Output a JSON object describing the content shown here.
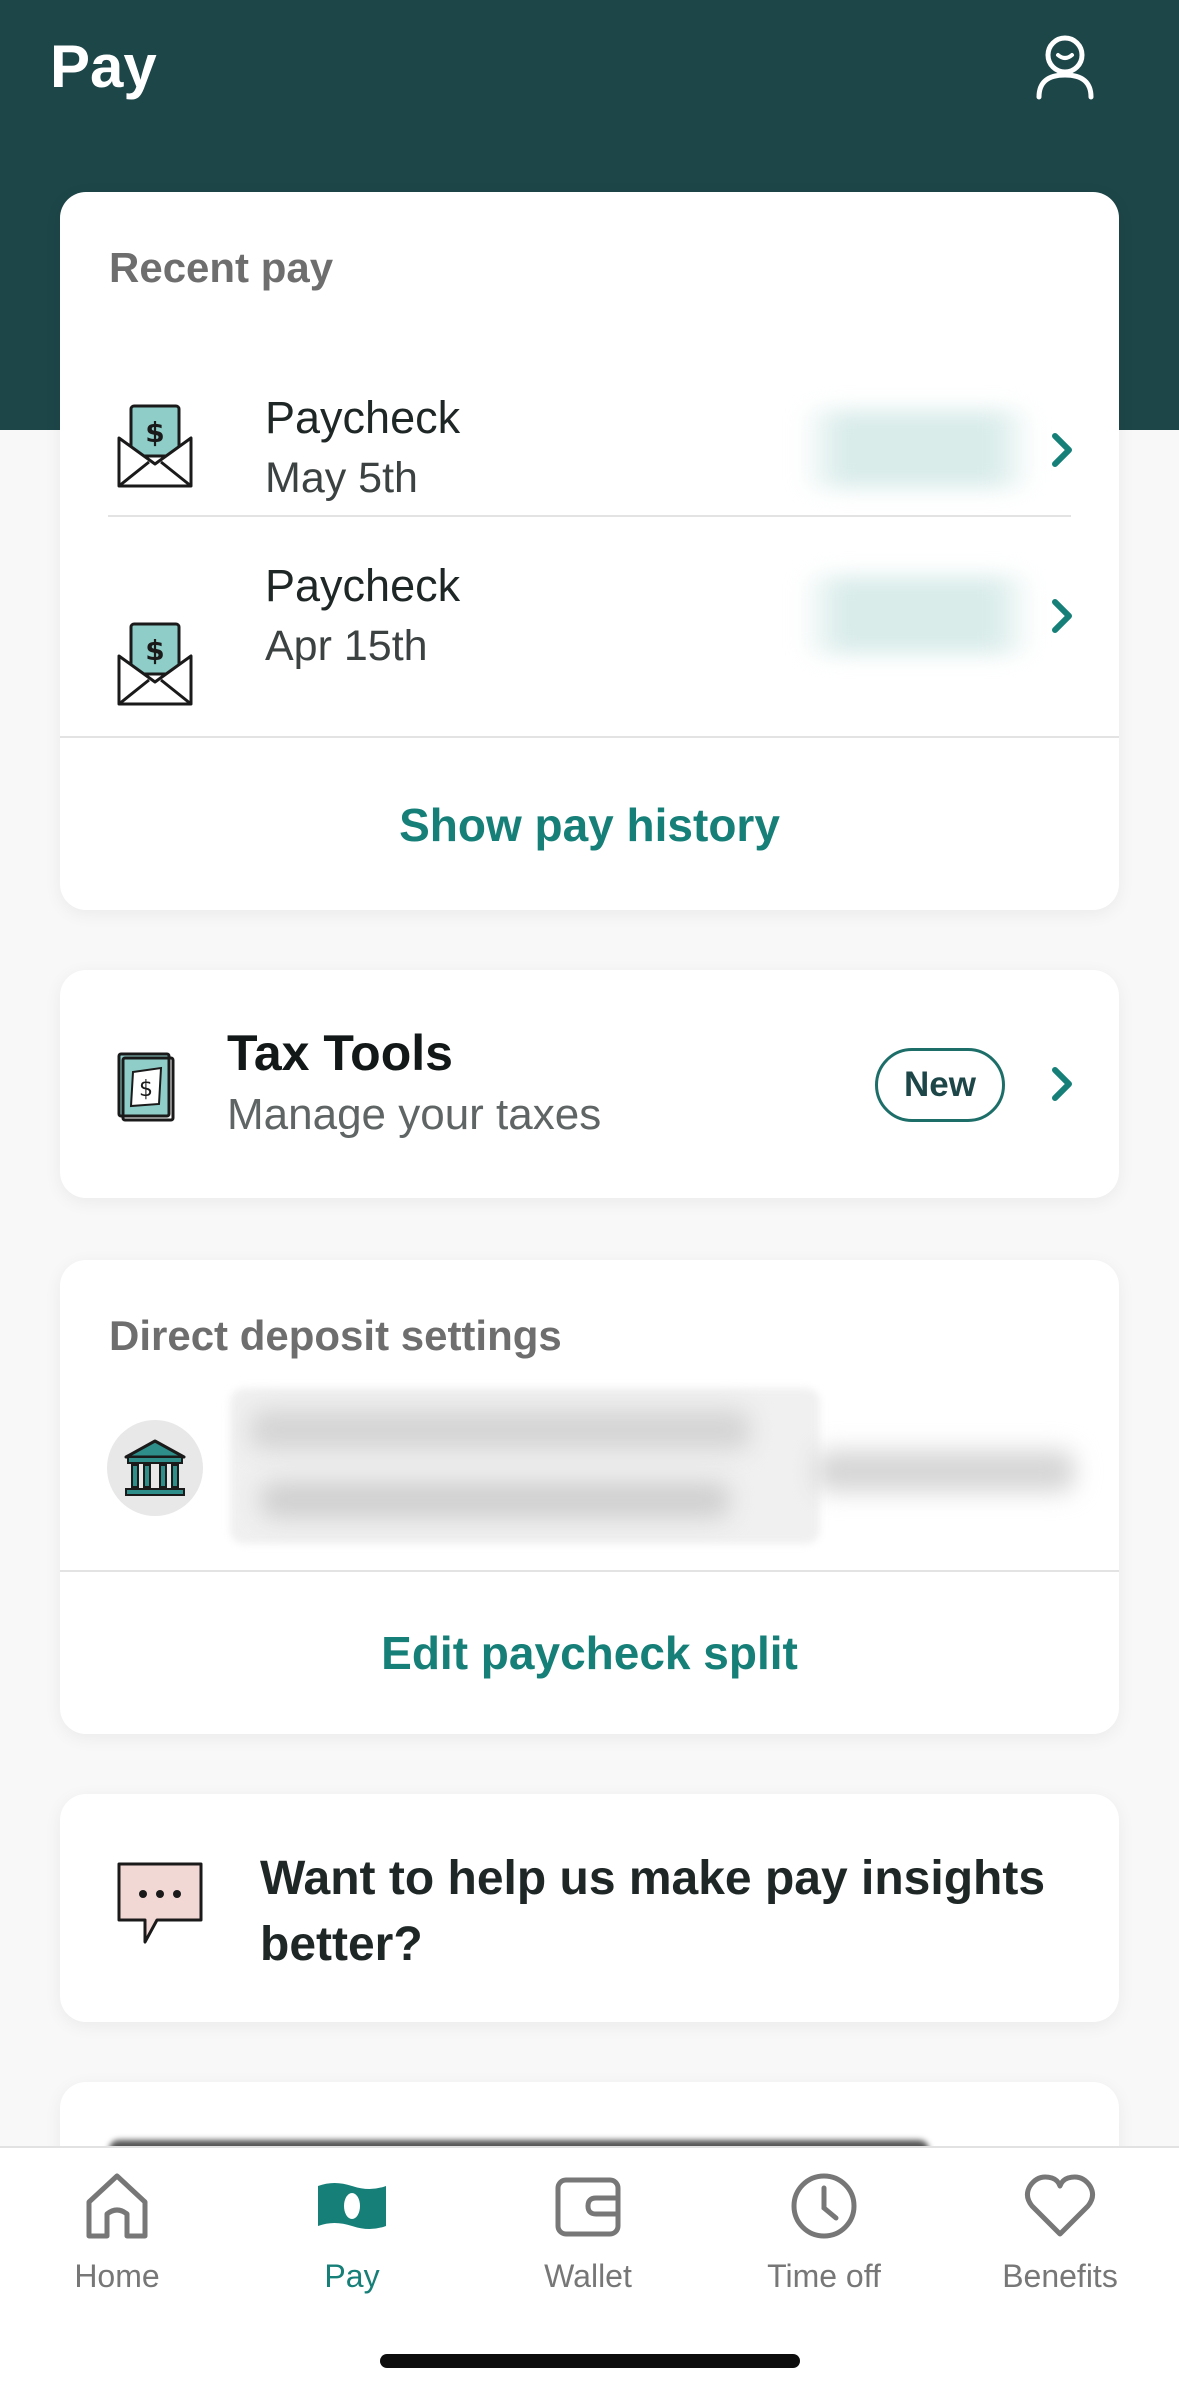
{
  "header": {
    "title": "Pay",
    "profile_icon": "profile-icon"
  },
  "recent_pay": {
    "section_title": "Recent pay",
    "items": [
      {
        "label": "Paycheck",
        "date": "May 5th",
        "icon": "envelope-money-icon"
      },
      {
        "label": "Paycheck",
        "date": "Apr 15th",
        "icon": "envelope-money-icon"
      }
    ],
    "show_history_label": "Show pay history"
  },
  "tax_tools": {
    "title": "Tax Tools",
    "subtitle": "Manage your taxes",
    "badge": "New",
    "icon": "tax-document-icon"
  },
  "direct_deposit": {
    "section_title": "Direct deposit settings",
    "icon": "bank-icon",
    "edit_label": "Edit paycheck split"
  },
  "feedback": {
    "text": "Want to help us make pay insights better?",
    "icon": "chat-bubble-icon"
  },
  "tabbar": {
    "tabs": [
      {
        "label": "Home",
        "icon": "home-icon",
        "active": false
      },
      {
        "label": "Pay",
        "icon": "pay-icon",
        "active": true
      },
      {
        "label": "Wallet",
        "icon": "wallet-icon",
        "active": false
      },
      {
        "label": "Time off",
        "icon": "clock-icon",
        "active": false
      },
      {
        "label": "Benefits",
        "icon": "heart-icon",
        "active": false
      }
    ]
  },
  "colors": {
    "header_bg": "#1d4649",
    "accent": "#157f78",
    "badge_border": "#1d6e69"
  }
}
